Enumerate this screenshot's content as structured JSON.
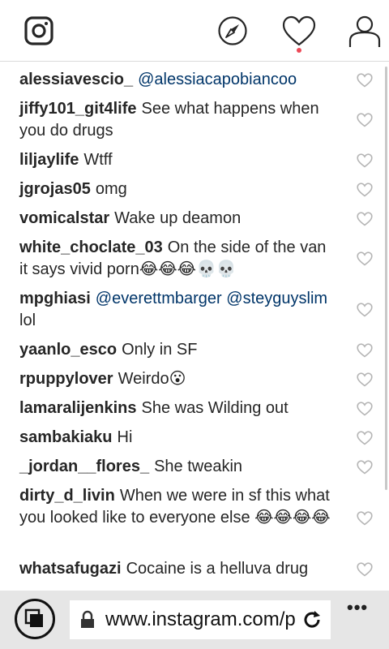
{
  "topbar": {
    "icons": [
      "instagram-logo-icon",
      "compass-icon",
      "heart-icon",
      "profile-icon"
    ],
    "notification_dot_color": "#ed4956"
  },
  "comments": [
    {
      "user": "alessiavescio_",
      "segments": [
        {
          "text": "@alessiacapobiancoo",
          "mention": true
        }
      ]
    },
    {
      "user": "jiffy101_git4life",
      "segments": [
        {
          "text": "See what happens when you do drugs",
          "mention": false
        }
      ]
    },
    {
      "user": "liljaylife",
      "segments": [
        {
          "text": "Wtff",
          "mention": false
        }
      ]
    },
    {
      "user": "jgrojas05",
      "segments": [
        {
          "text": "omg",
          "mention": false
        }
      ]
    },
    {
      "user": "vomicalstar",
      "segments": [
        {
          "text": "Wake up deamon",
          "mention": false
        }
      ]
    },
    {
      "user": "white_choclate_03",
      "segments": [
        {
          "text": "On the side of the van it says vivid porn😂😂😂💀💀",
          "mention": false
        }
      ]
    },
    {
      "user": "mpghiasi",
      "segments": [
        {
          "text": "@everettmbarger",
          "mention": true
        },
        {
          "text": " ",
          "mention": false
        },
        {
          "text": "@steyguyslim",
          "mention": true
        },
        {
          "text": " lol",
          "mention": false
        }
      ]
    },
    {
      "user": "yaanlo_esco",
      "segments": [
        {
          "text": "Only in SF",
          "mention": false
        }
      ]
    },
    {
      "user": "rpuppylover",
      "segments": [
        {
          "text": "Weirdo😮",
          "mention": false
        }
      ]
    },
    {
      "user": "lamaralijenkins",
      "segments": [
        {
          "text": "She was Wilding out",
          "mention": false
        }
      ]
    },
    {
      "user": "sambakiaku",
      "segments": [
        {
          "text": "Hi",
          "mention": false
        }
      ]
    },
    {
      "user": "_jordan__flores_",
      "segments": [
        {
          "text": "She tweakin",
          "mention": false
        }
      ]
    },
    {
      "user": "dirty_d_livin",
      "segments": [
        {
          "text": "When we were in sf this what you looked like to everyone else 😂😂😂😂",
          "mention": false
        }
      ]
    },
    {
      "user": "whatsafugazi",
      "segments": [
        {
          "text": "Cocaine is a helluva drug",
          "mention": false
        }
      ]
    }
  ],
  "browser": {
    "url": "www.instagram.com/p",
    "more_label": "•••"
  },
  "colors": {
    "mention": "#003569",
    "text": "#262626",
    "like_icon": "#b5b5b5",
    "browser_bar": "#e6e6e6"
  }
}
